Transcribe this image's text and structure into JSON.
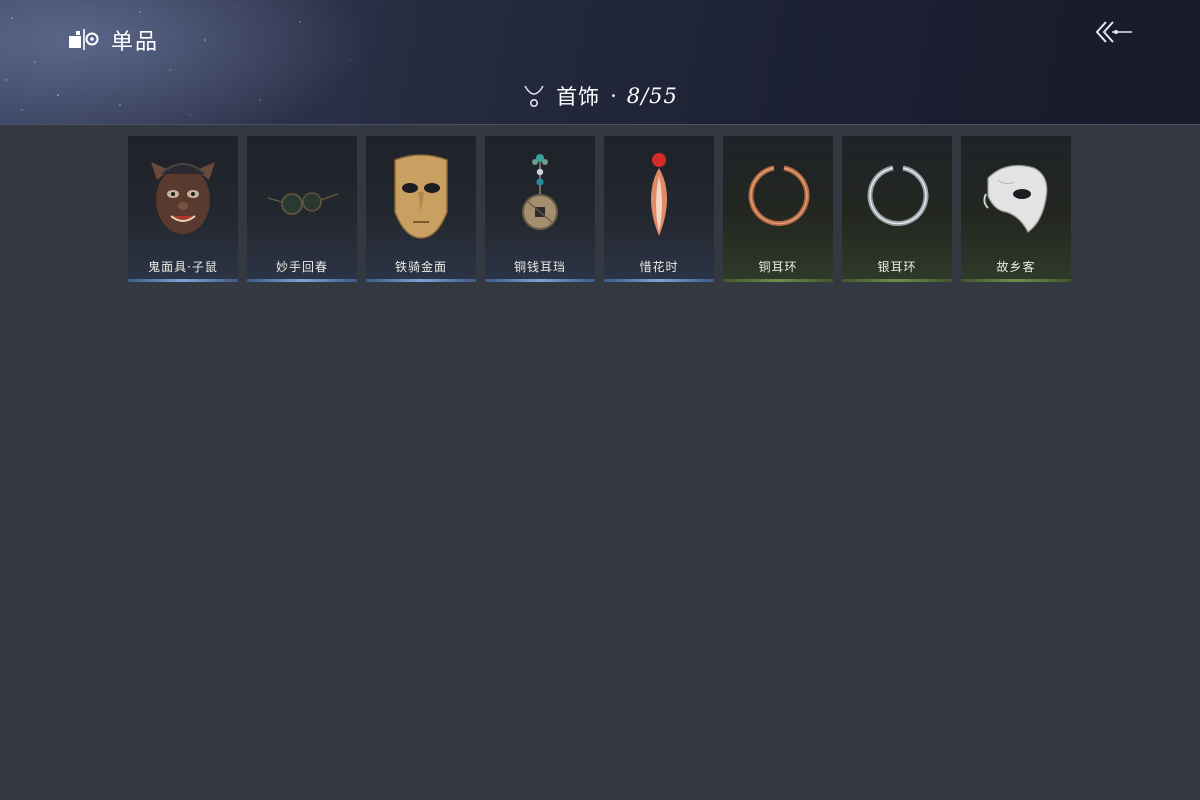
{
  "header": {
    "mode_title": "单品",
    "mode_icon": "single-item-icon",
    "back_icon": "back-arrow-icon"
  },
  "category": {
    "icon": "necklace-icon",
    "label": "首饰",
    "separator": "·",
    "count": "8/55"
  },
  "items": [
    {
      "name": "鬼面具·子鼠",
      "icon": "rat-mask-icon",
      "rarity_color": "#7fa3d8"
    },
    {
      "name": "妙手回春",
      "icon": "round-glasses-icon",
      "rarity_color": "#7fa3d8"
    },
    {
      "name": "铁骑金面",
      "icon": "gold-mask-icon",
      "rarity_color": "#7fa3d8"
    },
    {
      "name": "铜钱耳珰",
      "icon": "coin-earring-icon",
      "rarity_color": "#7fa3d8"
    },
    {
      "name": "惜花时",
      "icon": "petal-earring-icon",
      "rarity_color": "#7fa3d8"
    },
    {
      "name": "铜耳环",
      "icon": "copper-earring-icon",
      "rarity_color": "#6f8f4a"
    },
    {
      "name": "银耳环",
      "icon": "silver-earring-icon",
      "rarity_color": "#6f8f4a"
    },
    {
      "name": "故乡客",
      "icon": "white-half-mask-icon",
      "rarity_color": "#6f8f4a"
    }
  ]
}
